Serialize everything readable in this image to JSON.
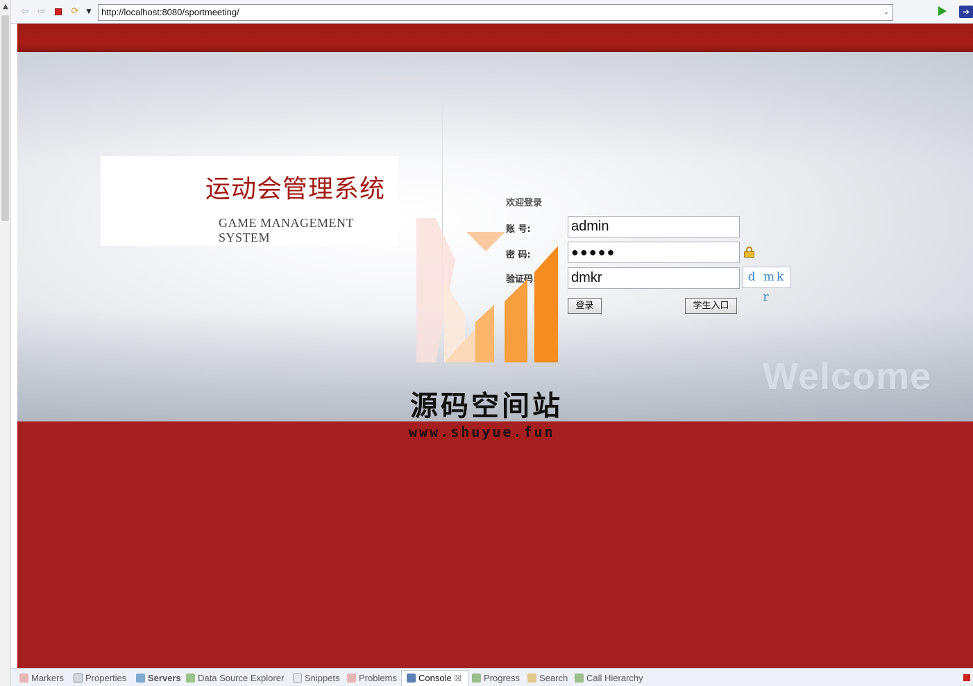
{
  "browser": {
    "url": "http://localhost:8080/sportmeeting/",
    "icons": [
      "back-icon",
      "forward-icon",
      "stop-icon",
      "refresh-icon",
      "menu-dropdown-icon",
      "go-icon",
      "external-browser-icon"
    ]
  },
  "brand": {
    "title": "运动会管理系统",
    "subtitle": "GAME MANAGEMENT SYSTEM"
  },
  "login": {
    "greeting": "欢迎登录",
    "account_label": "账 号:",
    "account_value": "admin",
    "password_label": "密 码:",
    "password_value": "●●●●●",
    "captcha_label": "验证码:",
    "captcha_value": "dmkr",
    "captcha_image_text": "d mk r",
    "login_button": "登录",
    "student_button": "学生入口"
  },
  "decor": {
    "welcome": "Welcome",
    "watermark_cn": "源码空间站",
    "watermark_url": "www.shuyue.fun"
  },
  "bottom_tabs": [
    {
      "label": "Markers",
      "icon": "markers-icon"
    },
    {
      "label": "Properties",
      "icon": "properties-icon"
    },
    {
      "label": "Servers",
      "icon": "servers-icon"
    },
    {
      "label": "Data Source Explorer",
      "icon": "data-source-icon"
    },
    {
      "label": "Snippets",
      "icon": "snippets-icon"
    },
    {
      "label": "Problems",
      "icon": "problems-icon"
    },
    {
      "label": "Console",
      "icon": "console-icon"
    },
    {
      "label": "Progress",
      "icon": "progress-icon"
    },
    {
      "label": "Search",
      "icon": "search-icon"
    },
    {
      "label": "Call Hierarchy",
      "icon": "call-hierarchy-icon"
    }
  ],
  "colors": {
    "brand_red": "#a51f1f",
    "title_red": "#a31b14",
    "logo_orange": "#f68b1f"
  }
}
